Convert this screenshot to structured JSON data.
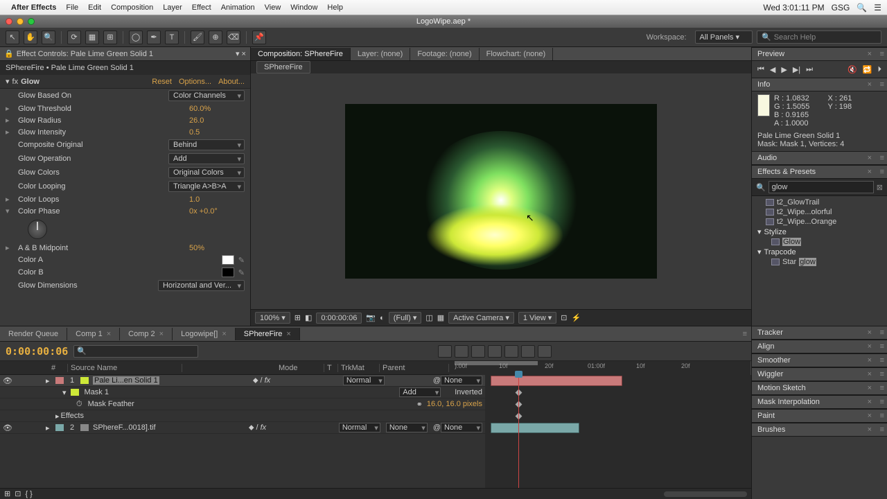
{
  "menubar": {
    "app": "After Effects",
    "items": [
      "File",
      "Edit",
      "Composition",
      "Layer",
      "Effect",
      "Animation",
      "View",
      "Window",
      "Help"
    ],
    "clock": "Wed 3:01:11 PM",
    "user": "GSG"
  },
  "window": {
    "title": "LogoWipe.aep *"
  },
  "toolbar": {
    "workspace_label": "Workspace:",
    "workspace_value": "All Panels",
    "search_placeholder": "Search Help"
  },
  "effect_controls": {
    "tab": "Effect Controls: Pale Lime Green Solid 1",
    "crumb": "SPhereFire • Pale Lime Green Solid 1",
    "effect_name": "Glow",
    "actions": {
      "reset": "Reset",
      "options": "Options...",
      "about": "About..."
    },
    "props": {
      "glow_based_on_label": "Glow Based On",
      "glow_based_on": "Color Channels",
      "glow_threshold_label": "Glow Threshold",
      "glow_threshold": "60.0%",
      "glow_radius_label": "Glow Radius",
      "glow_radius": "26.0",
      "glow_intensity_label": "Glow Intensity",
      "glow_intensity": "0.5",
      "composite_original_label": "Composite Original",
      "composite_original": "Behind",
      "glow_operation_label": "Glow Operation",
      "glow_operation": "Add",
      "glow_colors_label": "Glow Colors",
      "glow_colors": "Original Colors",
      "color_looping_label": "Color Looping",
      "color_looping": "Triangle A>B>A",
      "color_loops_label": "Color Loops",
      "color_loops": "1.0",
      "color_phase_label": "Color Phase",
      "color_phase": "0x +0.0°",
      "ab_midpoint_label": "A & B Midpoint",
      "ab_midpoint": "50%",
      "color_a_label": "Color A",
      "color_a": "#ffffff",
      "color_b_label": "Color B",
      "color_b": "#000000",
      "glow_dimensions_label": "Glow Dimensions",
      "glow_dimensions": "Horizontal and Ver..."
    }
  },
  "composition": {
    "tabs": {
      "comp": "Composition: SPhereFire",
      "layer": "Layer: (none)",
      "footage": "Footage: (none)",
      "flowchart": "Flowchart: (none)"
    },
    "subtab": "SPhereFire",
    "footer": {
      "zoom": "100%",
      "time": "0:00:00:06",
      "resolution": "(Full)",
      "camera": "Active Camera",
      "view": "1 View"
    }
  },
  "preview": {
    "title": "Preview"
  },
  "info": {
    "title": "Info",
    "r": "R : 1.0832",
    "g": "G : 1.5055",
    "b": "B : 0.9165",
    "a": "A : 1.0000",
    "x": "X : 261",
    "y": "Y : 198",
    "layer": "Pale Lime Green Solid 1",
    "mask": "Mask: Mask 1, Vertices: 4"
  },
  "audio": {
    "title": "Audio"
  },
  "effects_presets": {
    "title": "Effects & Presets",
    "search": "glow",
    "items": [
      {
        "label": "t2_GlowTrail",
        "indent": 2
      },
      {
        "label": "t2_Wipe...olorful",
        "indent": 2
      },
      {
        "label": "t2_Wipe...Orange",
        "indent": 2
      }
    ],
    "folders": [
      {
        "label": "Stylize",
        "children": [
          {
            "label": "Glow",
            "hl": true
          }
        ]
      },
      {
        "label": "Trapcode",
        "children": [
          {
            "label": "Starglow"
          }
        ]
      }
    ]
  },
  "side_panels": [
    "Tracker",
    "Align",
    "Smoother",
    "Wiggler",
    "Motion Sketch",
    "Mask Interpolation",
    "Paint",
    "Brushes"
  ],
  "timeline": {
    "tabs": [
      "Render Queue",
      "Comp 1",
      "Comp 2",
      "Logowipe[]",
      "SPhereFire"
    ],
    "active_tab": 4,
    "timecode": "0:00:00:06",
    "columns": {
      "num": "#",
      "source": "Source Name",
      "mode": "Mode",
      "trkmat": "TrkMat",
      "parent": "Parent"
    },
    "ruler": [
      "):00f",
      "10f",
      "20f",
      "01:00f",
      "10f",
      "20f"
    ],
    "layers": [
      {
        "num": "1",
        "color": "#c97a7a",
        "name": "Pale Li...en Solid 1",
        "mode": "Normal",
        "trkmat": "",
        "parent": "None",
        "selected": true,
        "children": [
          {
            "type": "mask",
            "name": "Mask 1",
            "mode": "Add",
            "inverted": "Inverted"
          },
          {
            "type": "prop",
            "name": "Mask Feather",
            "value": "16.0, 16.0 pixels"
          },
          {
            "type": "group",
            "name": "Effects"
          }
        ]
      },
      {
        "num": "2",
        "color": "#7aa8a8",
        "name": "SPhereF...0018].tif",
        "mode": "Normal",
        "trkmat": "None",
        "parent": "None"
      }
    ]
  }
}
